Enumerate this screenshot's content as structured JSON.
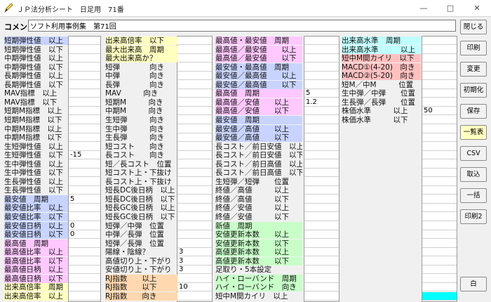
{
  "window": {
    "title": "ＪＰ法分析シート　日足用　71番",
    "controls": [
      "—",
      "□",
      "✕"
    ]
  },
  "comment": {
    "label": "コメント",
    "value": "ソフト利用事例集　第71回"
  },
  "buttons": [
    "閉じる",
    "印刷",
    "変更",
    "初期化",
    "保存",
    "一覧表",
    "CSV",
    "取込",
    "一括",
    "印刷2",
    "白"
  ],
  "colors": {
    "blue": "#c8d4ff",
    "yellow": "#ffffc0",
    "pink": "#ffc8ff",
    "green": "#c8ffc8",
    "orange": "#ffd8b0",
    "cyan": "#c0ffff",
    "salmon": "#ffc0c0",
    "cyanbox": "#00ffff"
  },
  "columns": [
    {
      "rows": [
        {
          "l": "短期弾性値　以上",
          "c": "blue",
          "v": ""
        },
        {
          "l": "短期弾性値　以下",
          "c": "",
          "v": ""
        },
        {
          "l": "中期弾性値　以上",
          "c": "",
          "v": ""
        },
        {
          "l": "中期弾性値　以下",
          "c": "",
          "v": ""
        },
        {
          "l": "長期弾性値　以上",
          "c": "",
          "v": ""
        },
        {
          "l": "長期弾性値　以下",
          "c": "",
          "v": ""
        },
        {
          "l": "MAV指標　以上",
          "c": "",
          "v": ""
        },
        {
          "l": "MAV指標　以下",
          "c": "",
          "v": ""
        },
        {
          "l": "短期M指標　以上",
          "c": "",
          "v": ""
        },
        {
          "l": "短期M指標　以下",
          "c": "",
          "v": ""
        },
        {
          "l": "中期M指標　以上",
          "c": "",
          "v": ""
        },
        {
          "l": "中期M指標　以下",
          "c": "",
          "v": ""
        },
        {
          "l": "生短弾性値　以上",
          "c": "",
          "v": ""
        },
        {
          "l": "生短弾性値　以下",
          "c": "",
          "v": "-15"
        },
        {
          "l": "生中弾性値　以上",
          "c": "",
          "v": ""
        },
        {
          "l": "生中弾性値　以下",
          "c": "",
          "v": ""
        },
        {
          "l": "生長弾性値　以上",
          "c": "",
          "v": ""
        },
        {
          "l": "生長弾性値　以下",
          "c": "",
          "v": ""
        },
        {
          "l": "最安値　周期",
          "c": "blue",
          "v": "5"
        },
        {
          "l": "最安値比率　以上",
          "c": "blue",
          "v": ""
        },
        {
          "l": "最安値比率　以下",
          "c": "blue",
          "v": ""
        },
        {
          "l": "最安値日柄　以上",
          "c": "blue",
          "v": "0"
        },
        {
          "l": "最安値日柄　以下",
          "c": "blue",
          "v": "0"
        },
        {
          "l": "最高値　周期",
          "c": "pink",
          "v": ""
        },
        {
          "l": "最高値比率　以上",
          "c": "pink",
          "v": ""
        },
        {
          "l": "最高値比率　以下",
          "c": "pink",
          "v": ""
        },
        {
          "l": "最高値日柄　以上",
          "c": "pink",
          "v": ""
        },
        {
          "l": "最高値日柄　以下",
          "c": "pink",
          "v": ""
        },
        {
          "l": "出来高倍率　周期",
          "c": "yellow",
          "v": ""
        },
        {
          "l": "出来高倍率　以上",
          "c": "yellow",
          "v": ""
        }
      ]
    },
    {
      "rows": [
        {
          "l": "出来高倍率　以下",
          "c": "yellow",
          "v": ""
        },
        {
          "l": "最大出来高　周期",
          "c": "yellow",
          "v": ""
        },
        {
          "l": "最大出来高か？",
          "c": "yellow",
          "v": ""
        },
        {
          "l": "短弾　　　　向き",
          "c": "",
          "v": ""
        },
        {
          "l": "中弾　　　　向き",
          "c": "",
          "v": ""
        },
        {
          "l": "長弾　　　　向き",
          "c": "",
          "v": ""
        },
        {
          "l": "MAV　　　向き",
          "c": "",
          "v": ""
        },
        {
          "l": "短期M　　　向き",
          "c": "",
          "v": ""
        },
        {
          "l": "中期M　　　向き",
          "c": "",
          "v": ""
        },
        {
          "l": "生短弾　　　向き",
          "c": "",
          "v": ""
        },
        {
          "l": "生中弾　　　向き",
          "c": "",
          "v": ""
        },
        {
          "l": "生長弾　　　向き",
          "c": "",
          "v": ""
        },
        {
          "l": "短コスト　　向き",
          "c": "",
          "v": ""
        },
        {
          "l": "長コスト　　向き",
          "c": "",
          "v": ""
        },
        {
          "l": "短／長コスト　位置",
          "c": "",
          "v": ""
        },
        {
          "l": "短コスト上・下抜け",
          "c": "",
          "v": ""
        },
        {
          "l": "長コスト上・下抜け",
          "c": "",
          "v": ""
        },
        {
          "l": "短長DC後日柄　以上",
          "c": "",
          "v": ""
        },
        {
          "l": "短長DC後日柄　以下",
          "c": "",
          "v": ""
        },
        {
          "l": "短長GC後日柄　以上",
          "c": "",
          "v": ""
        },
        {
          "l": "短長GC後日柄　以下",
          "c": "",
          "v": ""
        },
        {
          "l": "短弾／中弾　位置",
          "c": "",
          "v": ""
        },
        {
          "l": "中弾／長弾　位置",
          "c": "",
          "v": ""
        },
        {
          "l": "短弾／長弾　位置",
          "c": "",
          "v": ""
        },
        {
          "l": "陽線・陰線？",
          "c": "",
          "v": "3"
        },
        {
          "l": "高値切り上・下がり",
          "c": "",
          "v": "3"
        },
        {
          "l": "安値切り上・下がり",
          "c": "",
          "v": "3"
        },
        {
          "l": "RJ指数　　以上",
          "c": "orange",
          "v": ""
        },
        {
          "l": "RJ指数　　以下",
          "c": "orange",
          "v": "10"
        },
        {
          "l": "RJ指数　　向き",
          "c": "orange",
          "v": ""
        }
      ]
    },
    {
      "rows": [
        {
          "l": "最高値・最安値　周期",
          "c": "pink",
          "v": ""
        },
        {
          "l": "最高値／最安値　　以上",
          "c": "pink",
          "v": ""
        },
        {
          "l": "最高値／最安値　　以下",
          "c": "pink",
          "v": ""
        },
        {
          "l": "最安値・最高値　周期",
          "c": "blue",
          "v": ""
        },
        {
          "l": "最安値／最高値　　以上",
          "c": "blue",
          "v": ""
        },
        {
          "l": "最安値／最高値　　以下",
          "c": "blue",
          "v": ""
        },
        {
          "l": "最高値　周期",
          "c": "pink",
          "v": "5"
        },
        {
          "l": "最高値／安値　　以上",
          "c": "pink",
          "v": "1.2"
        },
        {
          "l": "最高値／安値　　以下",
          "c": "pink",
          "v": ""
        },
        {
          "l": "最安値　周期",
          "c": "blue",
          "v": ""
        },
        {
          "l": "最安値／高値　　以上",
          "c": "blue",
          "v": ""
        },
        {
          "l": "最安値／高値　　以下",
          "c": "blue",
          "v": ""
        },
        {
          "l": "長コスト／前日安値　以上",
          "c": "",
          "v": ""
        },
        {
          "l": "長コスト／前日安値　以下",
          "c": "",
          "v": ""
        },
        {
          "l": "長コスト／前日高値　以上",
          "c": "",
          "v": ""
        },
        {
          "l": "長コスト／前日高値　以下",
          "c": "",
          "v": ""
        },
        {
          "l": "生短弾／短弾　　位置",
          "c": "",
          "v": ""
        },
        {
          "l": "終値／高値　　　以上",
          "c": "",
          "v": ""
        },
        {
          "l": "終値／高値　　　以下",
          "c": "",
          "v": ""
        },
        {
          "l": "終値／安値　　　以上",
          "c": "",
          "v": ""
        },
        {
          "l": "終値／安値　　　以下",
          "c": "",
          "v": ""
        },
        {
          "l": "新値　周期",
          "c": "green",
          "v": ""
        },
        {
          "l": "安値更新本数　　以上",
          "c": "green",
          "v": ""
        },
        {
          "l": "安値更新本数　　以下",
          "c": "green",
          "v": ""
        },
        {
          "l": "高値更新本数　　以上",
          "c": "green",
          "v": ""
        },
        {
          "l": "高値更新本数　　以下",
          "c": "green",
          "v": ""
        },
        {
          "l": "足取り・5本設定",
          "c": "",
          "v": ""
        },
        {
          "l": "ハイ・ローバンド　周期",
          "c": "green",
          "v": ""
        },
        {
          "l": "ハイ・ローバンド　向き",
          "c": "green",
          "v": ""
        },
        {
          "l": "短中M間カイリ　以上",
          "c": "",
          "v": ""
        }
      ]
    },
    {
      "rows": [
        {
          "l": "出来高水準　周期",
          "c": "cyan",
          "v": ""
        },
        {
          "l": "出来高水準　　　以上",
          "c": "cyan",
          "v": ""
        },
        {
          "l": "短中M間カイリ　以下",
          "c": "salmon",
          "v": ""
        },
        {
          "l": "MACD①(4-20)　向き",
          "c": "salmon",
          "v": ""
        },
        {
          "l": "MACD②(5-20)　向き",
          "c": "salmon",
          "v": ""
        },
        {
          "l": "短M／中M　　　位置",
          "c": "",
          "v": ""
        },
        {
          "l": "生中弾／中弾　　位置",
          "c": "",
          "v": ""
        },
        {
          "l": "生長弾／長弾　　位置",
          "c": "",
          "v": ""
        },
        {
          "l": "株価水準　　　以上",
          "c": "",
          "v": "50"
        },
        {
          "l": "株価水準　　　以下",
          "c": "",
          "v": ""
        }
      ]
    }
  ]
}
